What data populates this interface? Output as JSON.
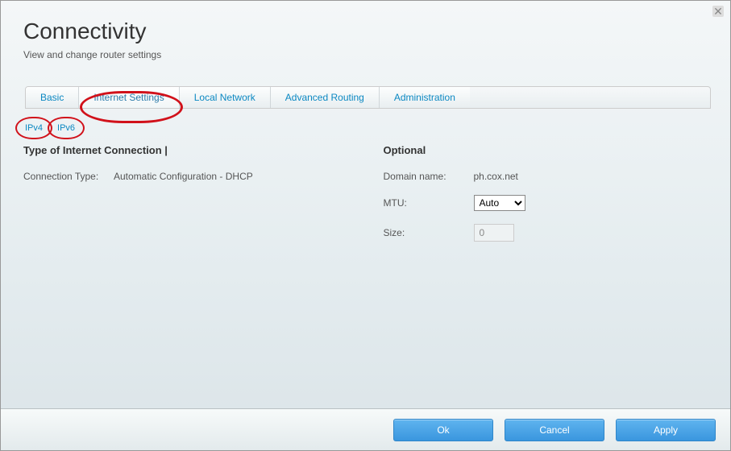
{
  "header": {
    "title": "Connectivity",
    "subtitle": "View and change router settings"
  },
  "tabs": [
    {
      "label": "Basic",
      "active": false
    },
    {
      "label": "Internet Settings",
      "active": true
    },
    {
      "label": "Local Network",
      "active": false
    },
    {
      "label": "Advanced Routing",
      "active": false
    },
    {
      "label": "Administration",
      "active": false
    }
  ],
  "subtabs": [
    {
      "label": "IPv4"
    },
    {
      "label": "IPv6"
    }
  ],
  "left": {
    "section_title": "Type of Internet Connection  |",
    "connection_type_label": "Connection Type:",
    "connection_type_value": "Automatic Configuration - DHCP"
  },
  "right": {
    "section_title": "Optional",
    "domain_label": "Domain name:",
    "domain_value": "ph.cox.net",
    "mtu_label": "MTU:",
    "mtu_value": "Auto",
    "size_label": "Size:",
    "size_value": "0"
  },
  "footer": {
    "ok": "Ok",
    "cancel": "Cancel",
    "apply": "Apply"
  }
}
